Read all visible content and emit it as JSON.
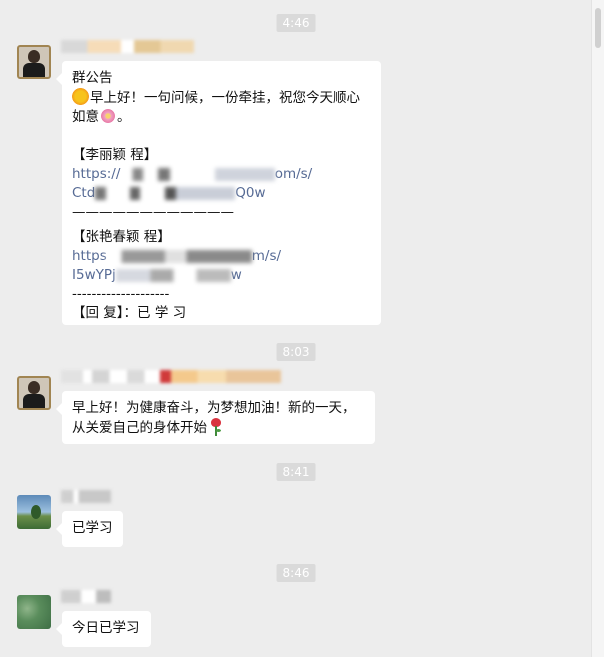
{
  "timestamps": [
    "4:46",
    "8:03",
    "8:41",
    "8:46"
  ],
  "messages": {
    "m1": {
      "title": "群公告",
      "greeting_a": "早上好！一句问候，一份牵挂，祝您今天顺心",
      "greeting_b": "如意",
      "greeting_end": "。",
      "section1_name": "【李丽颖 程】",
      "section1_link1_start": "https://",
      "section1_link1_end": "om/s/",
      "section1_link2_start": "Ctd",
      "section1_link2_end": "Q0w",
      "divider1": "————————————",
      "section2_name": "【张艳春颖 程】",
      "section2_link1_start": "https",
      "section2_link1_end": "m/s/",
      "section2_link2_start": "I5wYPj",
      "section2_link2_end": "w",
      "divider2": "--------------------",
      "reply_note": "【回 复】：已 学 习"
    },
    "m2": {
      "line1": "早上好！为健康奋斗，为梦想加油！新的一天，",
      "line2": "从关爱自己的身体开始"
    },
    "m3": {
      "text": "已学习"
    },
    "m4": {
      "text": "今日已学习"
    }
  },
  "icons": [
    "sun-icon",
    "flower-icon",
    "rose-icon"
  ],
  "colors": {
    "background": "#ededed",
    "bubble": "#ffffff",
    "link": "#576b95",
    "timestamp_bg": "#dadada"
  }
}
